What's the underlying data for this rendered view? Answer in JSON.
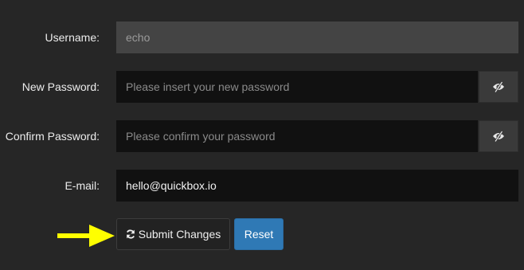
{
  "form": {
    "username": {
      "label": "Username:",
      "value": "echo"
    },
    "new_password": {
      "label": "New Password:",
      "value": "",
      "placeholder": "Please insert your new password",
      "toggle_icon": "eye-slash-icon"
    },
    "confirm_password": {
      "label": "Confirm Password:",
      "value": "",
      "placeholder": "Please confirm your password",
      "toggle_icon": "eye-slash-icon"
    },
    "email": {
      "label": "E-mail:",
      "value": "hello@quickbox.io"
    }
  },
  "actions": {
    "submit_label": "Submit Changes",
    "submit_icon": "refresh-icon",
    "reset_label": "Reset"
  },
  "annotation": {
    "icon": "arrow-right-icon",
    "color": "#ffff00"
  },
  "colors": {
    "background": "#262626",
    "input_bg": "#111111",
    "disabled_bg": "#444444",
    "primary": "#2f79b5"
  }
}
